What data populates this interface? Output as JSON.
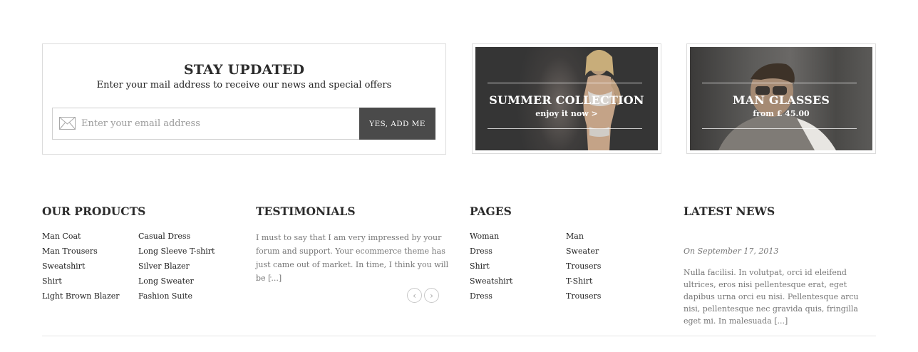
{
  "newsletter": {
    "title": "STAY UPDATED",
    "subtitle": "Enter your mail address to receive our news and special offers",
    "email_placeholder": "Enter your email address",
    "email_value": "",
    "button_label": "YES, ADD ME",
    "icon": "envelope-icon"
  },
  "banners": [
    {
      "title": "SUMMER COLLECTION",
      "subtitle": "enjoy it now >"
    },
    {
      "title": "MAN GLASSES",
      "subtitle": "from £ 45.00"
    }
  ],
  "footer": {
    "products": {
      "heading": "OUR PRODUCTS",
      "col1": [
        "Man Coat",
        "Man Trousers",
        "Sweatshirt",
        "Shirt",
        "Light Brown Blazer"
      ],
      "col2": [
        "Casual Dress",
        "Long Sleeve T-shirt",
        "Silver Blazer",
        "Long Sweater",
        "Fashion Suite"
      ]
    },
    "testimonials": {
      "heading": "TESTIMONIALS",
      "text": "I must to say that I am very impressed by your forum and support. Your ecommerce theme has just came out of market. In time, I think you will be [...]",
      "prev_icon": "chevron-left-icon",
      "next_icon": "chevron-right-icon"
    },
    "pages": {
      "heading": "PAGES",
      "col1": [
        "Woman",
        "Dress",
        "Shirt",
        "Sweatshirt",
        "Dress"
      ],
      "col2": [
        "Man",
        "Sweater",
        "Trousers",
        "T-Shirt",
        "Trousers"
      ]
    },
    "news": {
      "heading": "LATEST NEWS",
      "date": "On September 17, 2013",
      "text": "Nulla facilisi. In volutpat, orci id eleifend ultrices, eros nisi pellentesque erat, eget dapibus urna orci eu nisi. Pellentesque arcu nisi, pellentesque nec gravida quis, fringilla eget mi. In malesuada [...]"
    }
  }
}
